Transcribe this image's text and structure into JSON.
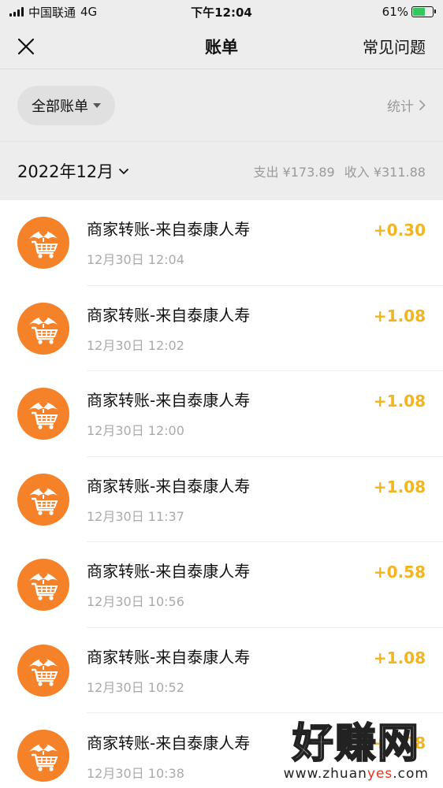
{
  "status_bar": {
    "carrier": "中国联通",
    "network": "4G",
    "time": "下午12:04",
    "battery": "61%",
    "battery_level": 0.61
  },
  "nav": {
    "title": "账单",
    "right": "常见问题"
  },
  "filter": {
    "label": "全部账单",
    "stats": "统计"
  },
  "month": {
    "label": "2022年12月",
    "expense": "支出 ¥173.89",
    "income": "收入 ¥311.88"
  },
  "transactions": [
    {
      "title": "商家转账-来自泰康人寿",
      "time": "12月30日 12:04",
      "amount": "+0.30"
    },
    {
      "title": "商家转账-来自泰康人寿",
      "time": "12月30日 12:02",
      "amount": "+1.08"
    },
    {
      "title": "商家转账-来自泰康人寿",
      "time": "12月30日 12:00",
      "amount": "+1.08"
    },
    {
      "title": "商家转账-来自泰康人寿",
      "time": "12月30日 11:37",
      "amount": "+1.08"
    },
    {
      "title": "商家转账-来自泰康人寿",
      "time": "12月30日 10:56",
      "amount": "+0.58"
    },
    {
      "title": "商家转账-来自泰康人寿",
      "time": "12月30日 10:52",
      "amount": "+1.08"
    },
    {
      "title": "商家转账-来自泰康人寿",
      "time": "12月30日 10:38",
      "amount": "+1.08"
    }
  ],
  "watermark": {
    "main": "好赚网",
    "sub_a": "www.zhuan",
    "sub_b": "yes",
    "sub_c": ".com"
  },
  "colors": {
    "accent_amount": "#f3b41f",
    "avatar_bg": "#f58228"
  },
  "icons": {
    "close": "close-icon",
    "caret": "caret-down-icon",
    "chevron": "chevron-right-icon",
    "merchant": "umbrella-cart-icon"
  }
}
